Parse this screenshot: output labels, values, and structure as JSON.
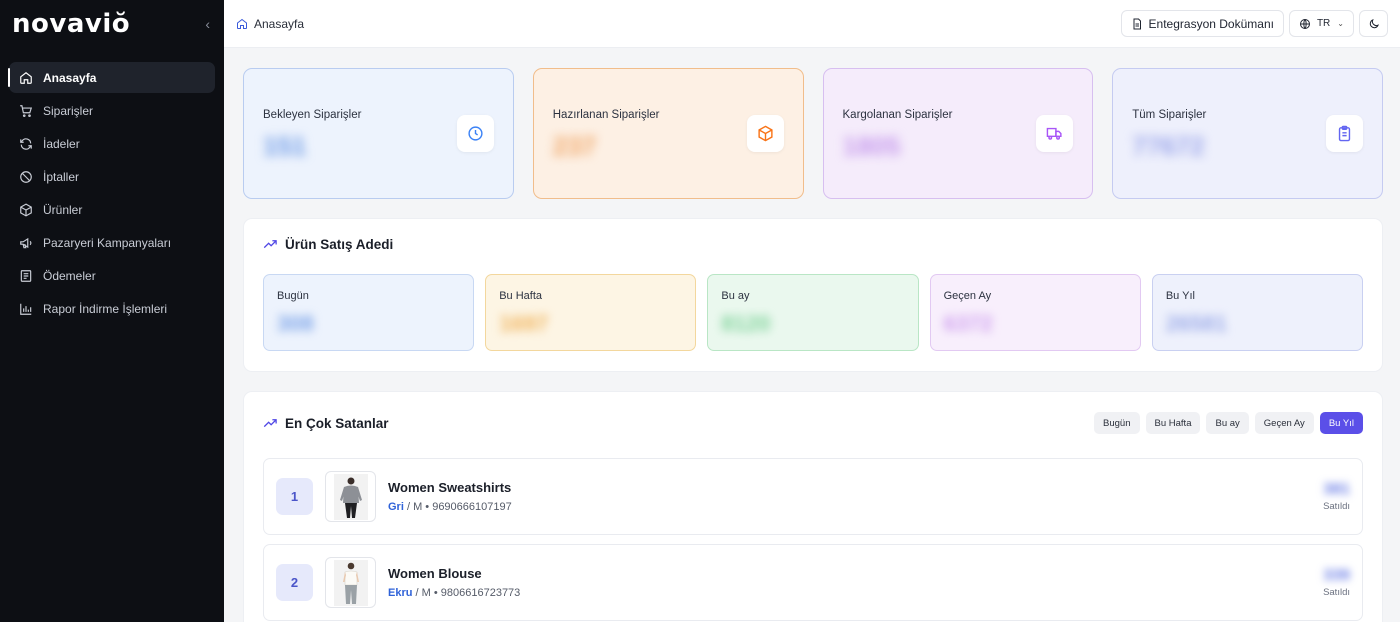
{
  "brand": {
    "logo": "novaviŏ"
  },
  "sidebar": {
    "items": [
      {
        "label": "Anasayfa",
        "icon": "home-icon",
        "active": true
      },
      {
        "label": "Siparişler",
        "icon": "cart-icon"
      },
      {
        "label": "İadeler",
        "icon": "refresh-icon"
      },
      {
        "label": "İptaller",
        "icon": "ban-icon"
      },
      {
        "label": "Ürünler",
        "icon": "package-icon"
      },
      {
        "label": "Pazaryeri Kampanyaları",
        "icon": "megaphone-icon"
      },
      {
        "label": "Ödemeler",
        "icon": "receipt-icon"
      },
      {
        "label": "Rapor İndirme İşlemleri",
        "icon": "bar-chart-icon"
      }
    ]
  },
  "header": {
    "breadcrumb": "Anasayfa",
    "doc_button": "Entegrasyon Dokümanı",
    "language": "TR"
  },
  "stats": [
    {
      "label": "Bekleyen Siparişler",
      "value": "151",
      "icon": "clock-icon",
      "color": "#3b82f6"
    },
    {
      "label": "Hazırlanan Siparişler",
      "value": "237",
      "icon": "box-icon",
      "color": "#f97316"
    },
    {
      "label": "Kargolanan Siparişler",
      "value": "1805",
      "icon": "truck-icon",
      "color": "#a855f7"
    },
    {
      "label": "Tüm Siparişler",
      "value": "77672",
      "icon": "clipboard-icon",
      "color": "#6366f1"
    }
  ],
  "sales": {
    "title": "Ürün Satış Adedi",
    "periods": [
      {
        "label": "Bugün",
        "value": "308"
      },
      {
        "label": "Bu Hafta",
        "value": "1697"
      },
      {
        "label": "Bu ay",
        "value": "8120"
      },
      {
        "label": "Geçen Ay",
        "value": "6372"
      },
      {
        "label": "Bu Yıl",
        "value": "26581"
      }
    ]
  },
  "best_sellers": {
    "title": "En Çok Satanlar",
    "filters": [
      {
        "label": "Bugün"
      },
      {
        "label": "Bu Hafta"
      },
      {
        "label": "Bu ay"
      },
      {
        "label": "Geçen Ay"
      },
      {
        "label": "Bu Yıl",
        "active": true
      }
    ],
    "sold_label": "Satıldı",
    "items": [
      {
        "rank": "1",
        "name": "Women Sweatshirts",
        "color": "Gri",
        "meta": " / M • 9690666107197",
        "sold": "381"
      },
      {
        "rank": "2",
        "name": "Women Blouse",
        "color": "Ekru",
        "meta": " / M • 9806616723773",
        "sold": "339"
      }
    ]
  }
}
